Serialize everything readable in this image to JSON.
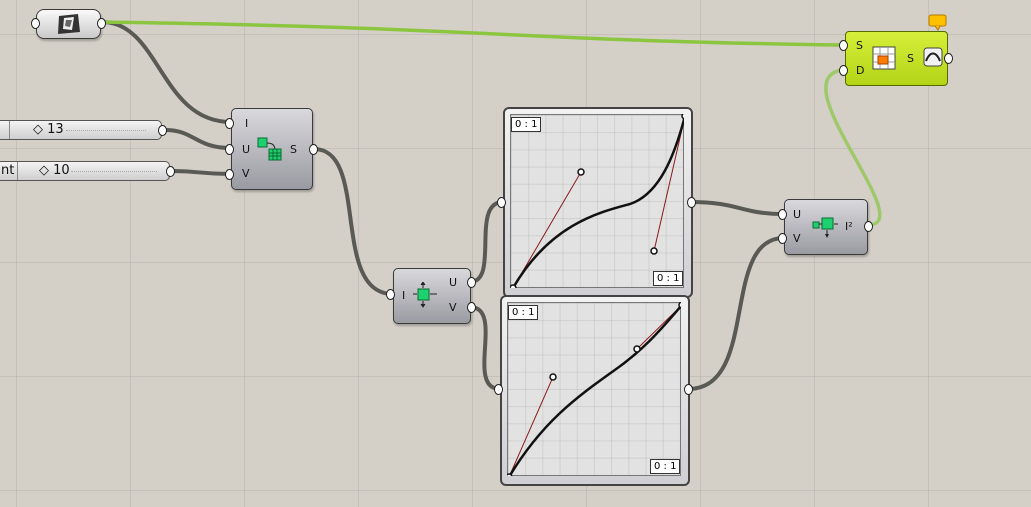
{
  "sliders": [
    {
      "value": "◇ 13",
      "left_label": ""
    },
    {
      "value": "◇ 10",
      "left_label": "nt"
    }
  ],
  "surface_from_grid": {
    "inputs": [
      "I",
      "U",
      "V"
    ],
    "output": "S"
  },
  "deconstruct_domain": {
    "input": "I",
    "outputs": [
      "U",
      "V"
    ]
  },
  "graph_top": {
    "domain_x": "0 : 1",
    "domain_y": "0 : 1"
  },
  "graph_bottom": {
    "domain_x": "0 : 1",
    "domain_y": "0 : 1"
  },
  "construct_domain2": {
    "inputs": [
      "U",
      "V"
    ],
    "output": "I²"
  },
  "divide_surface": {
    "inputs": [
      "S",
      "D"
    ],
    "output": "S"
  },
  "colors": {
    "wire": "#5a5a55",
    "active_wire": "#8cc640",
    "component_lime": "#c4e22a",
    "bezier": "#111111",
    "handle": "#8b1a1a"
  }
}
